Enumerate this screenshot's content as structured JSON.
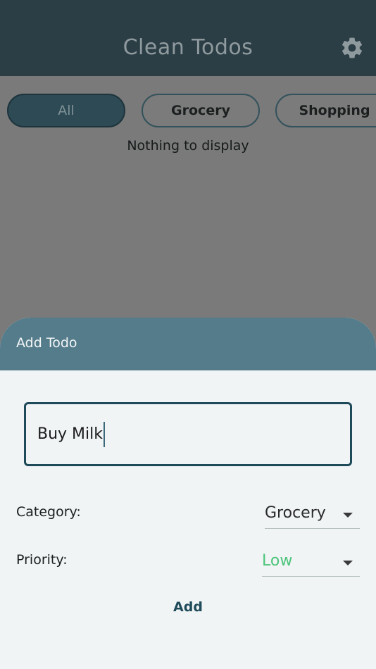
{
  "app_bar": {
    "title": "Clean Todos",
    "settings_icon": "gear-icon"
  },
  "filters": {
    "chips": [
      "All",
      "Grocery",
      "Shopping"
    ],
    "selected": "All"
  },
  "list": {
    "empty_message": "Nothing to display"
  },
  "sheet": {
    "title": "Add Todo",
    "input": {
      "value": "Buy Milk"
    },
    "category": {
      "label": "Category:",
      "value": "Grocery"
    },
    "priority": {
      "label": "Priority:",
      "value": "Low",
      "value_color": "#4cc47a"
    },
    "add_label": "Add"
  },
  "colors": {
    "appbar": "#2c3e45",
    "sheet_header": "#557c8b",
    "accent": "#1f4a5a"
  }
}
